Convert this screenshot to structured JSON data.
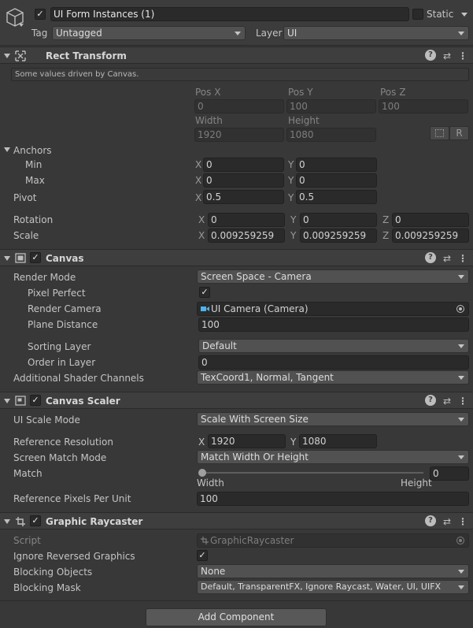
{
  "object": {
    "name": "UI Form Instances (1)",
    "active": true,
    "static_label": "Static",
    "tag_label": "Tag",
    "tag_value": "Untagged",
    "layer_label": "Layer",
    "layer_value": "UI"
  },
  "rect_transform": {
    "title": "Rect Transform",
    "notice": "Some values driven by Canvas.",
    "pos_x_label": "Pos X",
    "pos_y_label": "Pos Y",
    "pos_z_label": "Pos Z",
    "pos_x": "0",
    "pos_y": "100",
    "pos_z": "100",
    "width_label": "Width",
    "height_label": "Height",
    "width": "1920",
    "height": "1080",
    "r_button": "R",
    "anchors_label": "Anchors",
    "min_label": "Min",
    "max_label": "Max",
    "min_x": "0",
    "min_y": "0",
    "max_x": "0",
    "max_y": "0",
    "pivot_label": "Pivot",
    "pivot_x": "0.5",
    "pivot_y": "0.5",
    "rotation_label": "Rotation",
    "rot_x": "0",
    "rot_y": "0",
    "rot_z": "0",
    "scale_label": "Scale",
    "scale_x": "0.009259259",
    "scale_y": "0.009259259",
    "scale_z": "0.009259259",
    "x": "X",
    "y": "Y",
    "z": "Z"
  },
  "canvas": {
    "title": "Canvas",
    "enabled": true,
    "render_mode_label": "Render Mode",
    "render_mode": "Screen Space - Camera",
    "pixel_perfect_label": "Pixel Perfect",
    "pixel_perfect": true,
    "render_camera_label": "Render Camera",
    "render_camera": "UI Camera (Camera)",
    "plane_distance_label": "Plane Distance",
    "plane_distance": "100",
    "sorting_layer_label": "Sorting Layer",
    "sorting_layer": "Default",
    "order_in_layer_label": "Order in Layer",
    "order_in_layer": "0",
    "shader_channels_label": "Additional Shader Channels",
    "shader_channels": "TexCoord1, Normal, Tangent"
  },
  "canvas_scaler": {
    "title": "Canvas Scaler",
    "enabled": true,
    "ui_scale_mode_label": "UI Scale Mode",
    "ui_scale_mode": "Scale With Screen Size",
    "ref_res_label": "Reference Resolution",
    "ref_res_x": "1920",
    "ref_res_y": "1080",
    "screen_match_label": "Screen Match Mode",
    "screen_match": "Match Width Or Height",
    "match_label": "Match",
    "match_value": "0",
    "match_fraction": 0,
    "width_label": "Width",
    "height_label": "Height",
    "ppu_label": "Reference Pixels Per Unit",
    "ppu": "100"
  },
  "graphic_raycaster": {
    "title": "Graphic Raycaster",
    "enabled": true,
    "script_label": "Script",
    "script": "GraphicRaycaster",
    "ignore_reversed_label": "Ignore Reversed Graphics",
    "ignore_reversed": true,
    "blocking_objects_label": "Blocking Objects",
    "blocking_objects": "None",
    "blocking_mask_label": "Blocking Mask",
    "blocking_mask": "Default, TransparentFX, Ignore Raycast, Water, UI, UIFX"
  },
  "add_component": "Add Component",
  "icons": {
    "gameobject": "cube-icon",
    "help": "help-icon",
    "presets": "presets-icon",
    "menu": "kebab-menu-icon",
    "rect_transform": "rect-transform-icon",
    "canvas": "canvas-icon",
    "canvas_scaler": "canvas-scaler-icon",
    "raycaster": "raycaster-icon",
    "camera": "camera-icon",
    "target": "object-picker-icon"
  }
}
